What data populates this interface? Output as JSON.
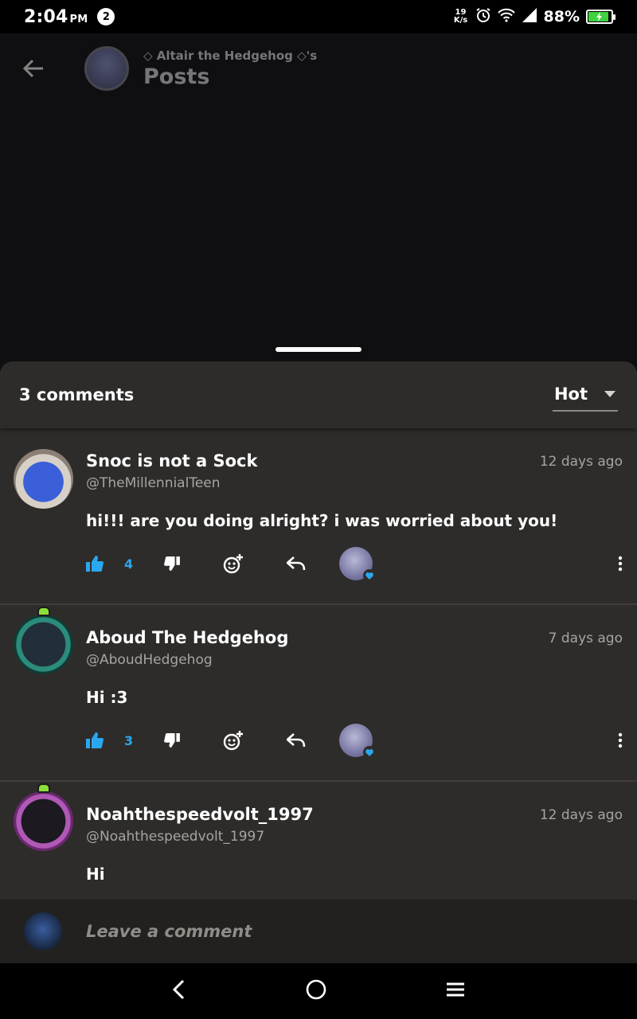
{
  "status_bar": {
    "time": "2:04",
    "ampm": "PM",
    "notification_count": "2",
    "net_speed_value": "19",
    "net_speed_unit": "K/s",
    "battery_percent": "88%",
    "battery_level": 0.88,
    "battery_color": "#3fd23f"
  },
  "header": {
    "subtitle": "◇ Altair the Hedgehog ◇'s",
    "title": "Posts"
  },
  "comments_sheet": {
    "count_label": "3 comments",
    "sort_label": "Hot"
  },
  "comments": [
    {
      "name": "Snoc is not a Sock",
      "handle": "@TheMillennialTeen",
      "time": "12 days ago",
      "body": "hi!!! are you doing alright? i was worried about you!",
      "likes": "4"
    },
    {
      "name": "Aboud The Hedgehog",
      "handle": "@AboudHedgehog",
      "time": "7 days ago",
      "body": "Hi :3",
      "likes": "3"
    },
    {
      "name": "Noahthespeedvolt_1997",
      "handle": "@Noahthespeedvolt_1997",
      "time": "12 days ago",
      "body": "Hi"
    }
  ],
  "comment_input": {
    "placeholder": "Leave a comment"
  },
  "colors": {
    "accent": "#29a8f0",
    "sheet_bg": "#2e2c2a"
  }
}
